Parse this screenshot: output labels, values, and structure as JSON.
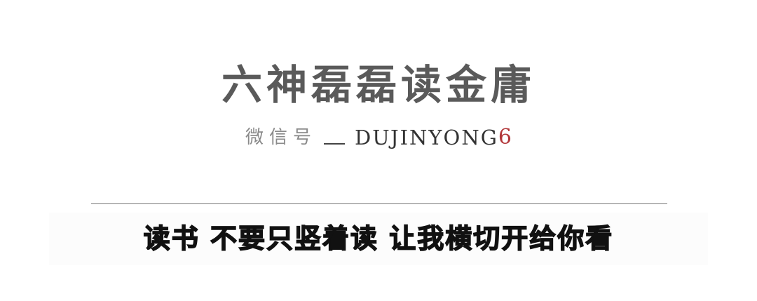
{
  "header": {
    "title": "六神磊磊读金庸",
    "wechat_label": "微信号",
    "wechat_id": "DUJINYONG",
    "wechat_id_suffix": "6"
  },
  "slogan": {
    "text": "读书 不要只竖着读 让我横切开给你看"
  },
  "colors": {
    "title": "#5a5a5a",
    "label": "#8a8a8a",
    "id": "#333333",
    "accent": "#b2373a",
    "slogan": "#111111",
    "divider": "#7a7a7a"
  }
}
